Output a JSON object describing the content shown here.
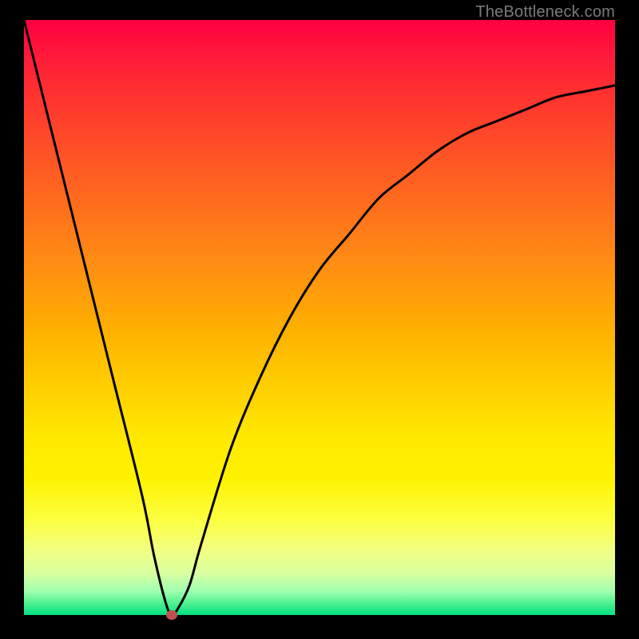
{
  "watermark": "TheBottleneck.com",
  "colors": {
    "background": "#000000",
    "curve": "#000000",
    "marker": "#c14f4f"
  },
  "chart_data": {
    "type": "line",
    "title": "",
    "xlabel": "",
    "ylabel": "",
    "xlim": [
      0,
      100
    ],
    "ylim": [
      0,
      100
    ],
    "grid": false,
    "legend": false,
    "series": [
      {
        "name": "bottleneck-curve",
        "x": [
          0,
          5,
          10,
          15,
          20,
          22,
          24,
          25,
          26,
          28,
          30,
          35,
          40,
          45,
          50,
          55,
          60,
          65,
          70,
          75,
          80,
          85,
          90,
          95,
          100
        ],
        "y": [
          100,
          80,
          60,
          40,
          20,
          10,
          2,
          0,
          1,
          5,
          12,
          28,
          40,
          50,
          58,
          64,
          70,
          74,
          78,
          81,
          83,
          85,
          87,
          88,
          89
        ]
      }
    ],
    "annotations": [
      {
        "name": "optimal-point",
        "x": 25,
        "y": 0
      }
    ]
  }
}
